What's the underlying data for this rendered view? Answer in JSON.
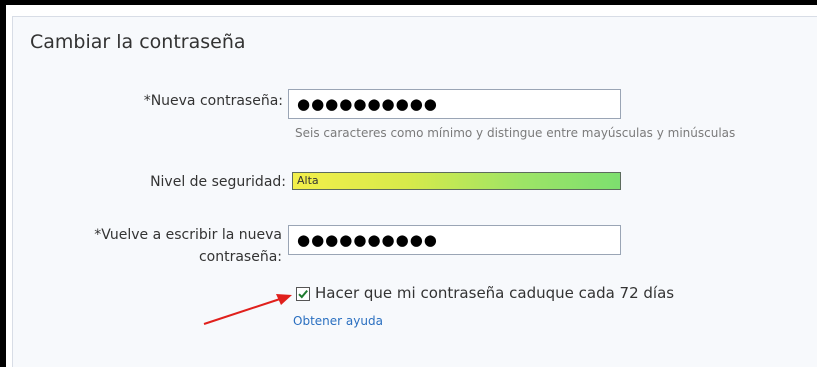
{
  "section": {
    "title": "Cambiar la contraseña"
  },
  "new_password": {
    "label": "*Nueva contraseña:",
    "value": "●●●●●●●●●●",
    "hint": "Seis caracteres como mínimo y distingue entre mayúsculas y minúsculas"
  },
  "strength": {
    "label": "Nivel de seguridad:",
    "level_text": "Alta"
  },
  "confirm_password": {
    "label_line1": "*Vuelve a escribir la nueva",
    "label_line2": "contraseña:",
    "value": "●●●●●●●●●●"
  },
  "expire_option": {
    "label": "Hacer que mi contraseña caduque cada 72 días",
    "checked": true
  },
  "help": {
    "link_text": "Obtener ayuda"
  },
  "colors": {
    "link": "#2a6fc0",
    "arrow": "#e0201c",
    "meter_start": "#f3ef4a",
    "meter_end": "#7ddf6f"
  },
  "icons": {
    "checkbox_mark": "check-mark-icon",
    "annotation": "red-arrow-icon"
  }
}
